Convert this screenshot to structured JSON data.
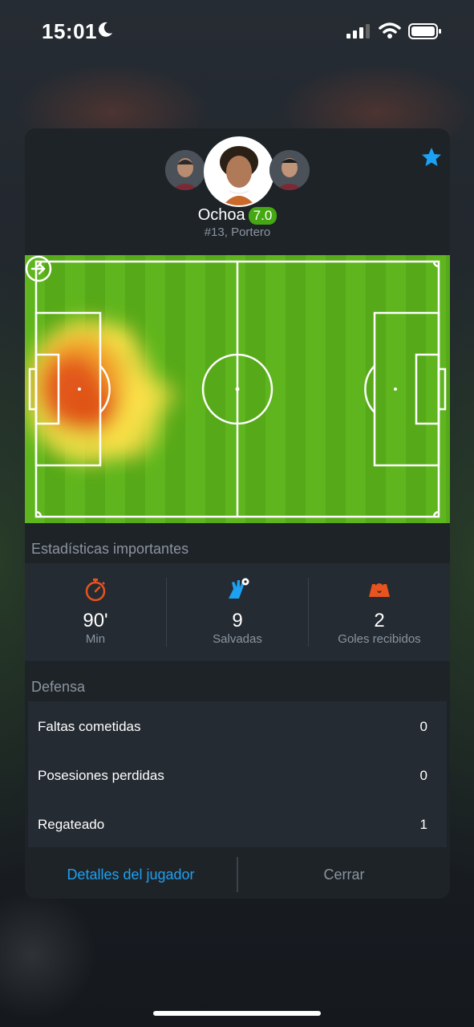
{
  "status_bar": {
    "time": "15:01",
    "icons": [
      "moon-icon",
      "signal-icon",
      "wifi-icon",
      "battery-icon"
    ]
  },
  "player": {
    "name": "Ochoa",
    "rating": "7.0",
    "subtitle": "#13, Portero",
    "favorite": true
  },
  "heatmap": {
    "direction_icon": "arrow-right-icon"
  },
  "key_stats": {
    "title": "Estadísticas importantes",
    "items": [
      {
        "value": "90'",
        "label": "Min",
        "icon": "stopwatch-icon"
      },
      {
        "value": "9",
        "label": "Salvadas",
        "icon": "goalkeeper-glove-icon"
      },
      {
        "value": "2",
        "label": "Goles recibidos",
        "icon": "goals-conceded-icon"
      }
    ]
  },
  "defense": {
    "title": "Defensa",
    "rows": [
      {
        "name": "Faltas cometidas",
        "value": "0"
      },
      {
        "name": "Posesiones perdidas",
        "value": "0"
      },
      {
        "name": "Regateado",
        "value": "1"
      }
    ]
  },
  "footer": {
    "details_label": "Detalles del jugador",
    "close_label": "Cerrar"
  },
  "colors": {
    "accent_blue": "#1da1f2",
    "rating_green": "#45a813",
    "icon_orange": "#e8531e",
    "pitch_green": "#5fb51d"
  }
}
